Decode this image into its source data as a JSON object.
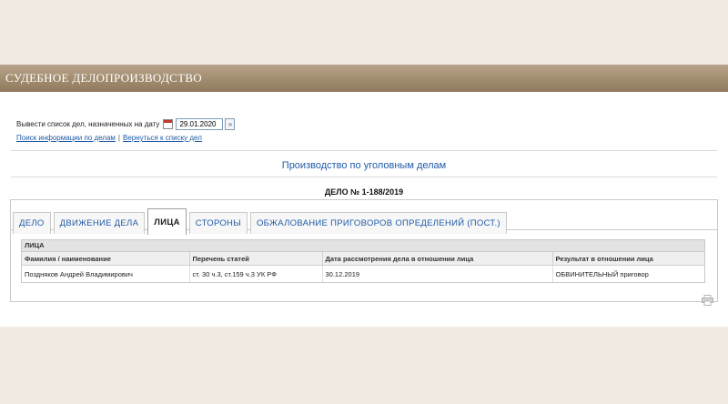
{
  "header": {
    "title": "СУДЕБНОЕ ДЕЛОПРОИЗВОДСТВО"
  },
  "date_filter": {
    "label": "Вывести список дел, назначенных на дату",
    "date_value": "29.01.2020",
    "go_label": "»"
  },
  "links": {
    "search": "Поиск информации по делам",
    "separator": "|",
    "back": "Вернуться к списку дел"
  },
  "page": {
    "section_title": "Производство по уголовным делам",
    "case_number": "ДЕЛО № 1-188/2019"
  },
  "tabs": [
    {
      "label": "ДЕЛО",
      "active": false
    },
    {
      "label": "ДВИЖЕНИЕ ДЕЛА",
      "active": false
    },
    {
      "label": "ЛИЦА",
      "active": true
    },
    {
      "label": "СТОРОНЫ",
      "active": false
    },
    {
      "label": "ОБЖАЛОВАНИЕ ПРИГОВОРОВ ОПРЕДЕЛЕНИЙ (ПОСТ.)",
      "active": false
    }
  ],
  "persons_table": {
    "caption": "ЛИЦА",
    "columns": [
      "Фамилия / наименование",
      "Перечень статей",
      "Дата рассмотрения дела в отношении лица",
      "Результат в отношении лица"
    ],
    "rows": [
      [
        "Поздняков Андрей Владимирович",
        "ст. 30 ч.3, ст.159 ч.3 УК РФ",
        "30.12.2019",
        "ОБВИНИТЕЛЬНЫЙ приговор"
      ]
    ]
  },
  "icons": {
    "calendar": "calendar-icon",
    "print": "print-icon"
  },
  "colors": {
    "header_bg": "#a08a6d",
    "link": "#1f5aa6",
    "page_bg": "#f1ebe4"
  }
}
